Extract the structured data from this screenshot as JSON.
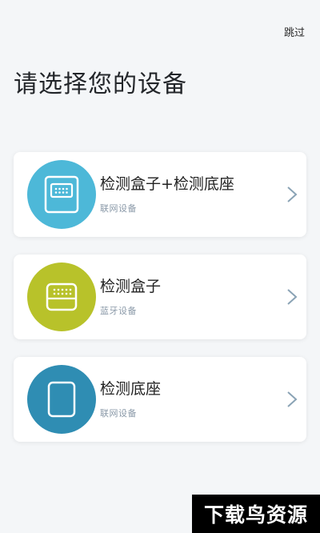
{
  "header": {
    "skip_label": "跳过",
    "title": "请选择您的设备"
  },
  "devices": [
    {
      "name": "检测盒子+检测底座",
      "subtitle": "联网设备",
      "icon": "box-and-base-icon",
      "color": "#4db8d8"
    },
    {
      "name": "检测盒子",
      "subtitle": "蓝牙设备",
      "icon": "box-icon",
      "color": "#b8c22a"
    },
    {
      "name": "检测底座",
      "subtitle": "联网设备",
      "icon": "base-icon",
      "color": "#2f8db3"
    }
  ],
  "watermark": {
    "text": "下载鸟资源"
  }
}
